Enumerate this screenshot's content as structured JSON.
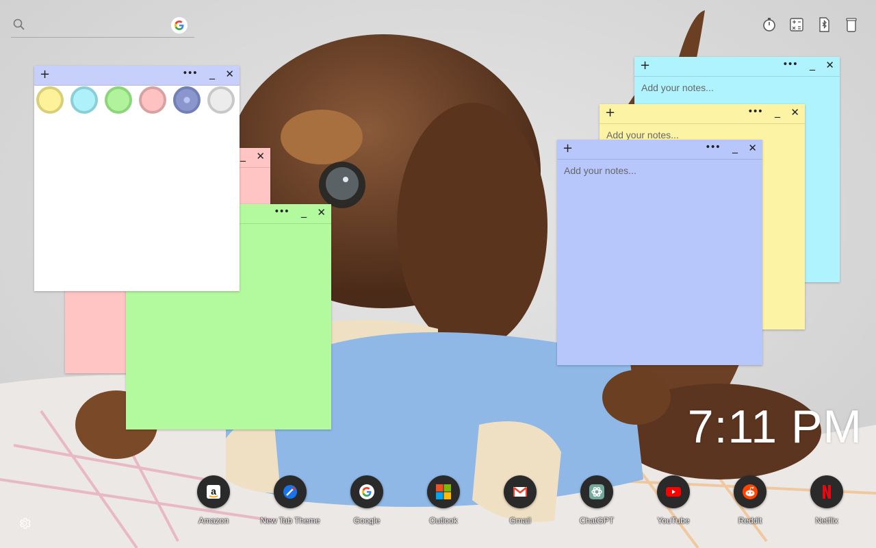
{
  "search": {
    "placeholder": "",
    "search_icon": "search-icon",
    "engine_icon": "google-g-icon"
  },
  "top_tools": [
    {
      "name": "timer-icon"
    },
    {
      "name": "calculator-icon"
    },
    {
      "name": "bluetooth-file-icon"
    },
    {
      "name": "trash-icon"
    }
  ],
  "note_controls": {
    "add": "+",
    "more": "•••",
    "minimize": "_",
    "close": "✕"
  },
  "notes": {
    "white": {
      "color": "#ffffff",
      "bar_color": "#c7d0fb"
    },
    "pink": {
      "color": "#ffc4c4"
    },
    "green": {
      "color": "#b3f99d"
    },
    "cyan": {
      "color": "#aef3fd",
      "placeholder": "Add your notes..."
    },
    "yellow": {
      "color": "#fdf3a5",
      "placeholder": "Add your notes..."
    },
    "blue": {
      "color": "#b7c6fb",
      "placeholder": "Add your notes..."
    }
  },
  "palette": [
    "#fdf29a",
    "#aef1fb",
    "#b0f39c",
    "#ffc2c2",
    "#8a97cc",
    "#ececec"
  ],
  "clock": {
    "time": "7:11 PM"
  },
  "shortcuts": [
    {
      "label": "Amazon",
      "icon": "amazon-icon"
    },
    {
      "label": "New Tab Theme",
      "icon": "new-tab-theme-icon"
    },
    {
      "label": "Google",
      "icon": "google-icon"
    },
    {
      "label": "Outlook",
      "icon": "microsoft-icon"
    },
    {
      "label": "Gmail",
      "icon": "gmail-icon"
    },
    {
      "label": "ChatGPT",
      "icon": "chatgpt-icon"
    },
    {
      "label": "YouTube",
      "icon": "youtube-icon"
    },
    {
      "label": "Reddit",
      "icon": "reddit-icon"
    },
    {
      "label": "Netflix",
      "icon": "netflix-icon"
    }
  ],
  "settings_icon": "gear-icon"
}
